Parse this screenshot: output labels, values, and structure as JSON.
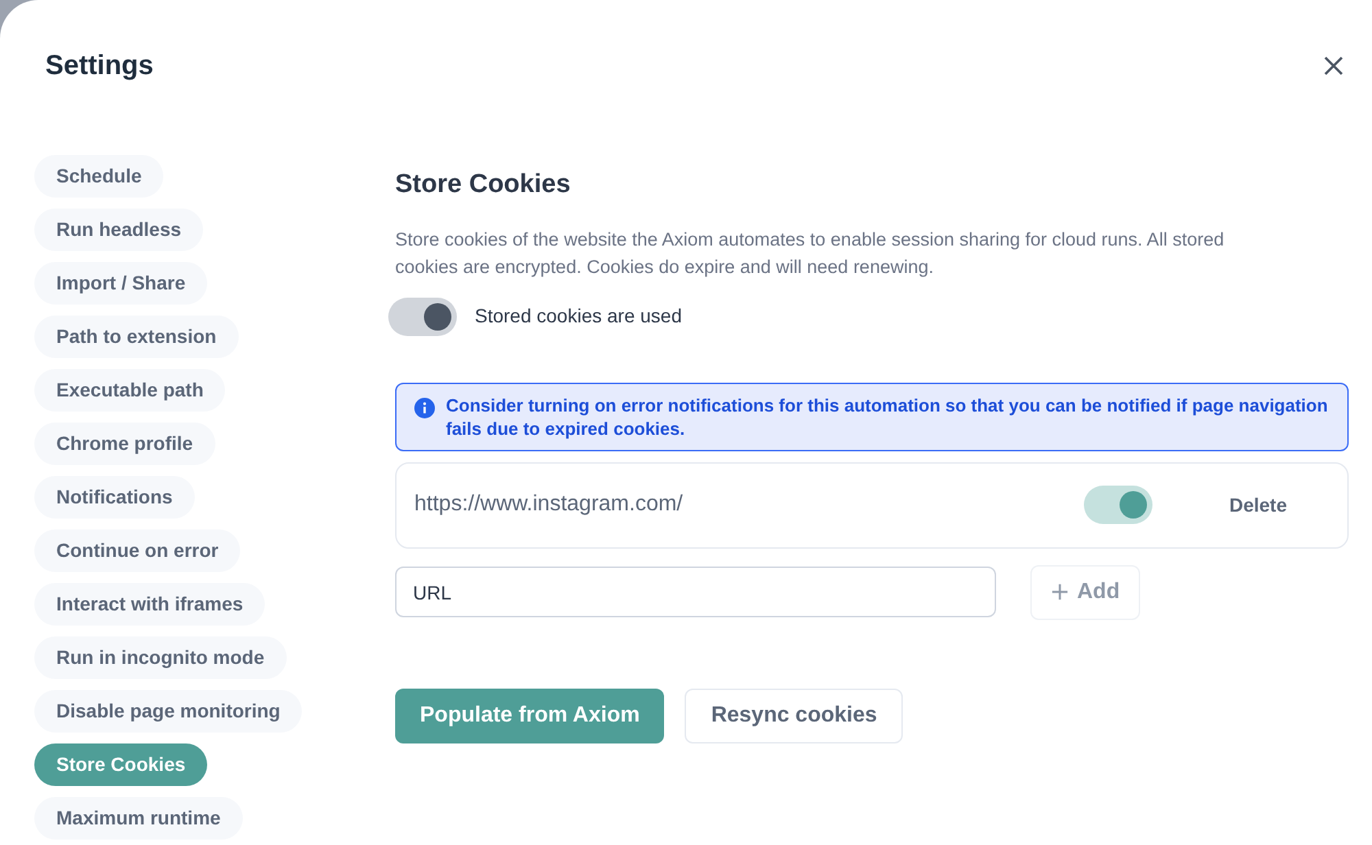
{
  "dialog": {
    "title": "Settings"
  },
  "sidebar": {
    "items": [
      {
        "label": "Schedule",
        "selected": false
      },
      {
        "label": "Run headless",
        "selected": false
      },
      {
        "label": "Import / Share",
        "selected": false
      },
      {
        "label": "Path to extension",
        "selected": false
      },
      {
        "label": "Executable path",
        "selected": false
      },
      {
        "label": "Chrome profile",
        "selected": false
      },
      {
        "label": "Notifications",
        "selected": false
      },
      {
        "label": "Continue on error",
        "selected": false
      },
      {
        "label": "Interact with iframes",
        "selected": false
      },
      {
        "label": "Run in incognito mode",
        "selected": false
      },
      {
        "label": "Disable page monitoring",
        "selected": false
      },
      {
        "label": "Store Cookies",
        "selected": true
      },
      {
        "label": "Maximum runtime",
        "selected": false
      }
    ]
  },
  "section": {
    "title": "Store Cookies",
    "description": "Store cookies of the website the Axiom automates to enable session sharing for cloud runs. All stored cookies are encrypted. Cookies do expire and will need renewing.",
    "main_toggle": {
      "label": "Stored cookies are used",
      "on": true
    },
    "notice": "Consider turning on error notifications for this automation so that you can be notified if page navigation fails due to expired cookies.",
    "cookies": [
      {
        "url": "https://www.instagram.com/",
        "on": true,
        "delete_label": "Delete"
      }
    ],
    "url_field": {
      "placeholder": "URL"
    },
    "add_button": {
      "label": "Add",
      "disabled": true
    },
    "buttons": [
      {
        "label": "Populate from Axiom",
        "kind": "primary"
      },
      {
        "label": "Resync cookies",
        "kind": "secondary"
      }
    ]
  }
}
